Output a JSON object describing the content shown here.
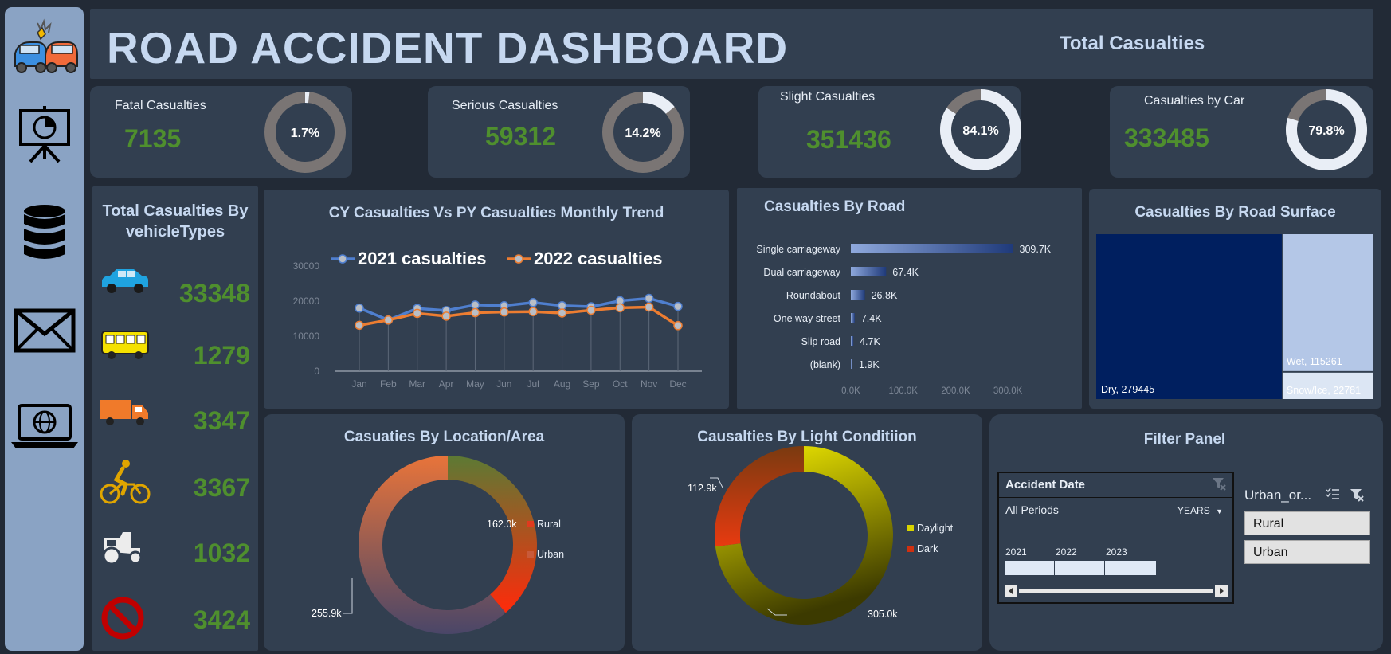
{
  "header": {
    "title": "ROAD ACCIDENT DASHBOARD",
    "total_label": "Total Casualties"
  },
  "sidebar": {
    "icons": [
      "car-crash-icon",
      "presentation-icon",
      "database-icon",
      "mail-icon",
      "laptop-globe-icon"
    ]
  },
  "kpis": [
    {
      "label": "Fatal Casualties",
      "value": "7135",
      "percent_label": "1.7%",
      "percent": 1.7
    },
    {
      "label": "Serious Casualties",
      "value": "59312",
      "percent_label": "14.2%",
      "percent": 14.2
    },
    {
      "label": "Slight Casualties",
      "value": "351436",
      "percent_label": "84.1%",
      "percent": 84.1
    },
    {
      "label": "Casualties by Car",
      "value": "333485",
      "percent_label": "79.8%",
      "percent": 79.8
    }
  ],
  "vehicles": {
    "title_line1": "Total Casualties By",
    "title_line2": "vehicleTypes",
    "items": [
      {
        "icon": "car-icon",
        "value": "33348"
      },
      {
        "icon": "bus-icon",
        "value": "1279"
      },
      {
        "icon": "truck-icon",
        "value": "3347"
      },
      {
        "icon": "bicycle-icon",
        "value": "3367"
      },
      {
        "icon": "tractor-icon",
        "value": "1032"
      },
      {
        "icon": "prohibited-icon",
        "value": "3424"
      }
    ]
  },
  "filter": {
    "title": "Filter Panel",
    "timeline": {
      "title": "Accident Date",
      "period": "All Periods",
      "level": "YEARS",
      "years": [
        "2021",
        "2022",
        "2023"
      ]
    },
    "slicer": {
      "title": "Urban_or...",
      "items": [
        "Rural",
        "Urban"
      ]
    }
  },
  "colors": {
    "green_value": "#4f8f2e",
    "cy": "#4f7fcf",
    "py": "#ed7d31",
    "panel": "#323f50",
    "bg": "#222a36"
  },
  "chart_data": [
    {
      "id": "trend",
      "type": "line",
      "title": "CY Casualties Vs PY Casualties Monthly Trend",
      "categories": [
        "Jan",
        "Feb",
        "Mar",
        "Apr",
        "May",
        "Jun",
        "Jul",
        "Aug",
        "Sep",
        "Oct",
        "Nov",
        "Dec"
      ],
      "series": [
        {
          "name": "2021 casualties",
          "color": "#4f7fcf",
          "values": [
            18000,
            14600,
            17900,
            17300,
            18900,
            18700,
            19600,
            18700,
            18400,
            20100,
            20800,
            18500
          ]
        },
        {
          "name": "2022 casualties",
          "color": "#ed7d31",
          "values": [
            13100,
            14600,
            16500,
            15700,
            16700,
            16900,
            17000,
            16600,
            17400,
            18100,
            18300,
            13000
          ]
        }
      ],
      "yticks": [
        "0",
        "10000",
        "20000",
        "30000"
      ],
      "ylim": [
        0,
        30000
      ],
      "legend": "top"
    },
    {
      "id": "road",
      "type": "bar",
      "orientation": "horizontal",
      "title": "Casualties By Road",
      "categories": [
        "Single carriageway",
        "Dual carriageway",
        "Roundabout",
        "One way street",
        "Slip road",
        "(blank)"
      ],
      "values": [
        309700,
        67400,
        26800,
        7400,
        4700,
        1900
      ],
      "labels": [
        "309.7K",
        "67.4K",
        "26.8K",
        "7.4K",
        "4.7K",
        "1.9K"
      ],
      "xticks": [
        "0.0K",
        "100.0K",
        "200.0K",
        "300.0K"
      ],
      "xlim": [
        0,
        350000
      ]
    },
    {
      "id": "surface",
      "type": "treemap",
      "title": "Casualties By Road Surface",
      "items": [
        {
          "name": "Dry",
          "value": 279445,
          "label": "Dry, 279445",
          "color": "#001f5f"
        },
        {
          "name": "Wet",
          "value": 115261,
          "label": "Wet, 115261",
          "color": "#b4c7e7"
        },
        {
          "name": "Snow/Ice",
          "value": 22781,
          "label": "Snow/Ice, 22781",
          "color": "#dce6f4"
        }
      ]
    },
    {
      "id": "location",
      "type": "pie",
      "variant": "donut",
      "title": "Casuaties By Location/Area",
      "slices": [
        {
          "name": "Rural",
          "value": 162000,
          "label": "162.0k",
          "color": "#e03a1e"
        },
        {
          "name": "Urban",
          "value": 255900,
          "label": "255.9k",
          "color": "#c85a3a"
        }
      ],
      "legend": "right"
    },
    {
      "id": "light",
      "type": "pie",
      "variant": "donut",
      "title": "Causalties By Light Conditiion",
      "slices": [
        {
          "name": "Daylight",
          "value": 305000,
          "label": "305.0k",
          "color": "#d8d400"
        },
        {
          "name": "Dark",
          "value": 112900,
          "label": "112.9k",
          "color": "#d03010"
        }
      ],
      "legend": "right"
    }
  ]
}
